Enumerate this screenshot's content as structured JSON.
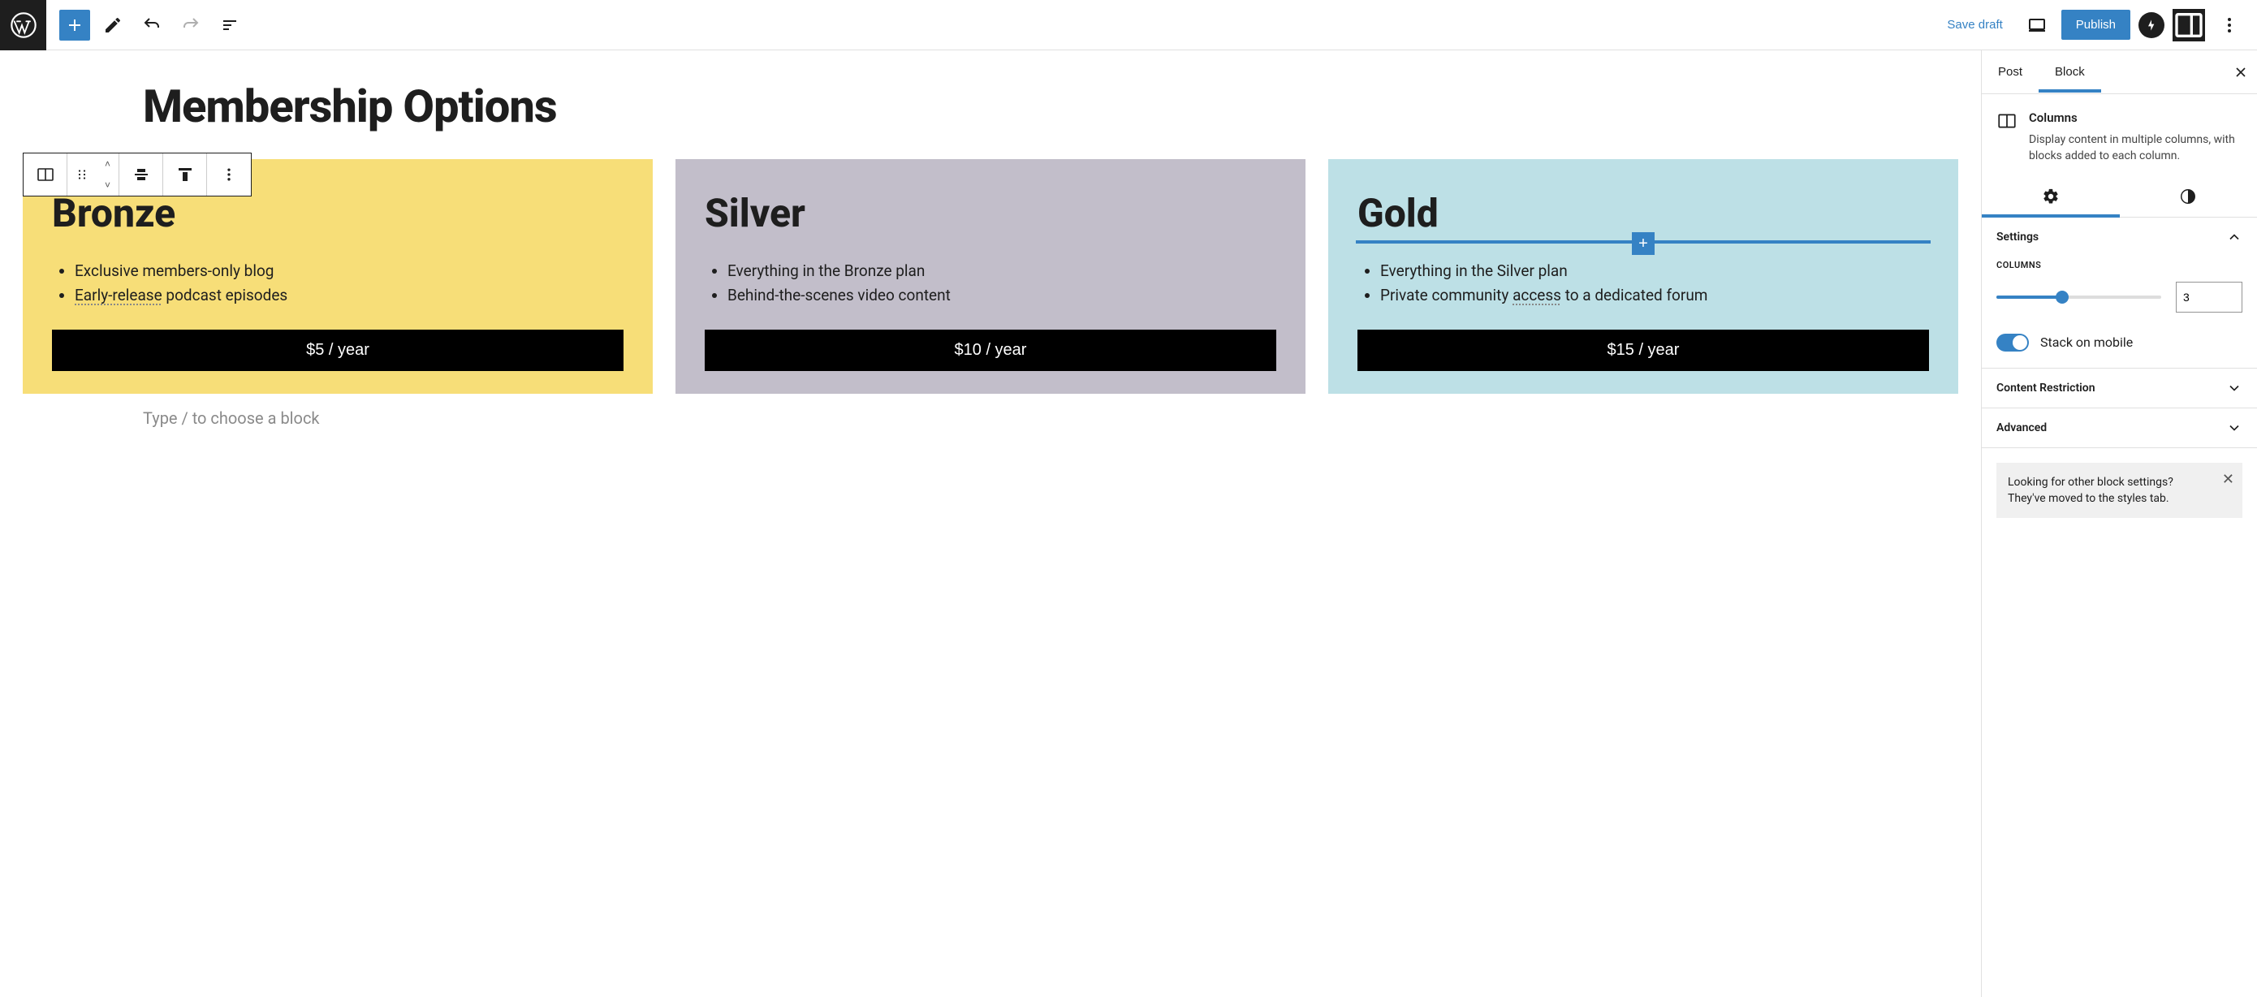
{
  "topbar": {
    "save_draft": "Save draft",
    "publish": "Publish"
  },
  "page_heading": "Membership Options",
  "type_hint": "Type / to choose a block",
  "cards": [
    {
      "title": "Bronze",
      "features": [
        {
          "pre": "Exclusive members-only blog",
          "dotted": "",
          "post": ""
        },
        {
          "pre": "",
          "dotted": "Early-release",
          "post": " podcast episodes"
        }
      ],
      "price": "$5 / year"
    },
    {
      "title": "Silver",
      "features": [
        {
          "pre": "Everything in the Bronze plan",
          "dotted": "",
          "post": ""
        },
        {
          "pre": "Behind-the-scenes video content",
          "dotted": "",
          "post": ""
        }
      ],
      "price": "$10 / year"
    },
    {
      "title": "Gold",
      "features": [
        {
          "pre": "Everything in the Silver plan",
          "dotted": "",
          "post": ""
        },
        {
          "pre": "Private community ",
          "dotted": "access",
          "post": " to a dedicated forum"
        }
      ],
      "price": "$15 / year"
    }
  ],
  "sidebar": {
    "tabs": {
      "post": "Post",
      "block": "Block"
    },
    "block": {
      "title": "Columns",
      "desc": "Display content in multiple columns, with blocks added to each column."
    },
    "panels": {
      "settings": "Settings",
      "columns_label": "COLUMNS",
      "columns_value": "3",
      "stack_label": "Stack on mobile",
      "content_restriction": "Content Restriction",
      "advanced": "Advanced"
    },
    "notice": "Looking for other block settings? They've moved to the styles tab."
  }
}
